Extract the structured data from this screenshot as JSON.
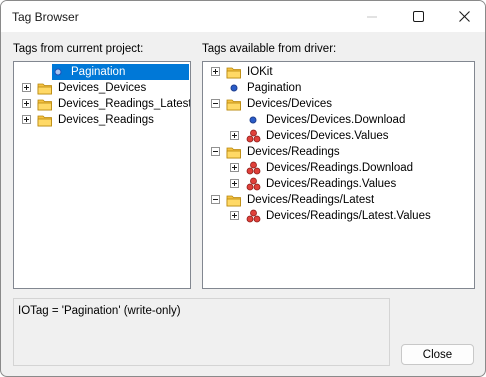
{
  "window": {
    "title": "Tag Browser"
  },
  "left_panel": {
    "label": "Tags from current project:",
    "items": [
      {
        "label": "Pagination",
        "icon": "blue-dot-tag-icon",
        "selected": true
      },
      {
        "label": "Devices_Devices",
        "icon": "folder-icon"
      },
      {
        "label": "Devices_Readings_Latest",
        "icon": "folder-icon"
      },
      {
        "label": "Devices_Readings",
        "icon": "folder-icon"
      }
    ]
  },
  "right_panel": {
    "label": "Tags available from driver:",
    "items": [
      {
        "label": "IOKit",
        "icon": "folder-icon",
        "expander": "plus"
      },
      {
        "label": "Pagination",
        "icon": "blue-dot-tag-icon"
      },
      {
        "label": "Devices/Devices",
        "icon": "folder-icon",
        "expander": "minus"
      },
      {
        "label": "Devices/Devices.Download",
        "icon": "blue-dot-tag-icon"
      },
      {
        "label": "Devices/Devices.Values",
        "icon": "red-cluster-tag-icon",
        "expander": "plus"
      },
      {
        "label": "Devices/Readings",
        "icon": "folder-icon",
        "expander": "minus"
      },
      {
        "label": "Devices/Readings.Download",
        "icon": "red-cluster-tag-icon",
        "expander": "plus"
      },
      {
        "label": "Devices/Readings.Values",
        "icon": "red-cluster-tag-icon",
        "expander": "plus"
      },
      {
        "label": "Devices/Readings/Latest",
        "icon": "folder-icon",
        "expander": "minus"
      },
      {
        "label": "Devices/Readings/Latest.Values",
        "icon": "red-cluster-tag-icon",
        "expander": "plus"
      }
    ]
  },
  "status": {
    "text": "IOTag = 'Pagination' (write-only)"
  },
  "buttons": {
    "close_label": "Close"
  },
  "colors": {
    "selection": "#0078d7",
    "folder": "#f5c242",
    "tag_dot": "#1f4fb5",
    "cluster": "#d9302c"
  }
}
